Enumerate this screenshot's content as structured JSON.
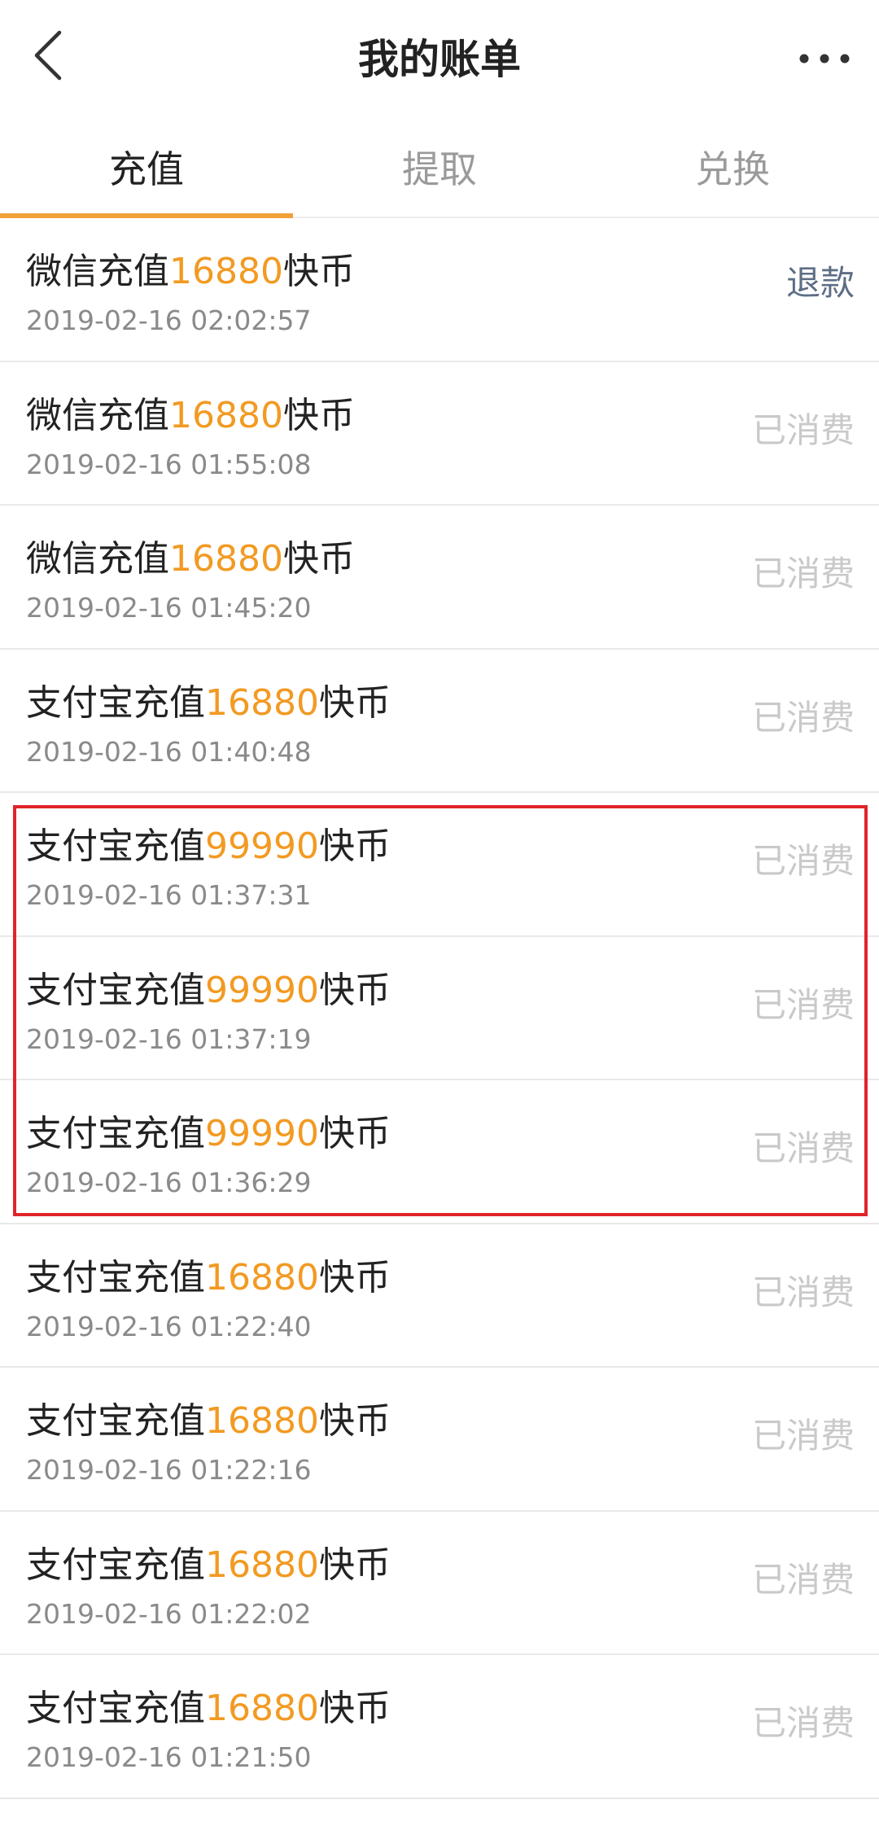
{
  "header": {
    "title": "我的账单",
    "back_icon": "chevron-left-icon",
    "more_icon": "more-horizontal-icon"
  },
  "tabs": [
    {
      "label": "充值",
      "active": true
    },
    {
      "label": "提取",
      "active": false
    },
    {
      "label": "兑换",
      "active": false
    }
  ],
  "colors": {
    "accent": "#f2a03a",
    "amount": "#f29a22",
    "refund": "#5d6e85",
    "consumed": "#c9c9c9",
    "highlight": "#e0242a"
  },
  "records": [
    {
      "prefix": "微信充值",
      "amount": "16880",
      "suffix": "快币",
      "time": "2019-02-16 02:02:57",
      "status": "退款"
    },
    {
      "prefix": "微信充值",
      "amount": "16880",
      "suffix": "快币",
      "time": "2019-02-16 01:55:08",
      "status": "已消费"
    },
    {
      "prefix": "微信充值",
      "amount": "16880",
      "suffix": "快币",
      "time": "2019-02-16 01:45:20",
      "status": "已消费"
    },
    {
      "prefix": "支付宝充值",
      "amount": "16880",
      "suffix": "快币",
      "time": "2019-02-16 01:40:48",
      "status": "已消费"
    },
    {
      "prefix": "支付宝充值",
      "amount": "99990",
      "suffix": "快币",
      "time": "2019-02-16 01:37:31",
      "status": "已消费"
    },
    {
      "prefix": "支付宝充值",
      "amount": "99990",
      "suffix": "快币",
      "time": "2019-02-16 01:37:19",
      "status": "已消费"
    },
    {
      "prefix": "支付宝充值",
      "amount": "99990",
      "suffix": "快币",
      "time": "2019-02-16 01:36:29",
      "status": "已消费"
    },
    {
      "prefix": "支付宝充值",
      "amount": "16880",
      "suffix": "快币",
      "time": "2019-02-16 01:22:40",
      "status": "已消费"
    },
    {
      "prefix": "支付宝充值",
      "amount": "16880",
      "suffix": "快币",
      "time": "2019-02-16 01:22:16",
      "status": "已消费"
    },
    {
      "prefix": "支付宝充值",
      "amount": "16880",
      "suffix": "快币",
      "time": "2019-02-16 01:22:02",
      "status": "已消费"
    },
    {
      "prefix": "支付宝充值",
      "amount": "16880",
      "suffix": "快币",
      "time": "2019-02-16 01:21:50",
      "status": "已消费"
    }
  ]
}
